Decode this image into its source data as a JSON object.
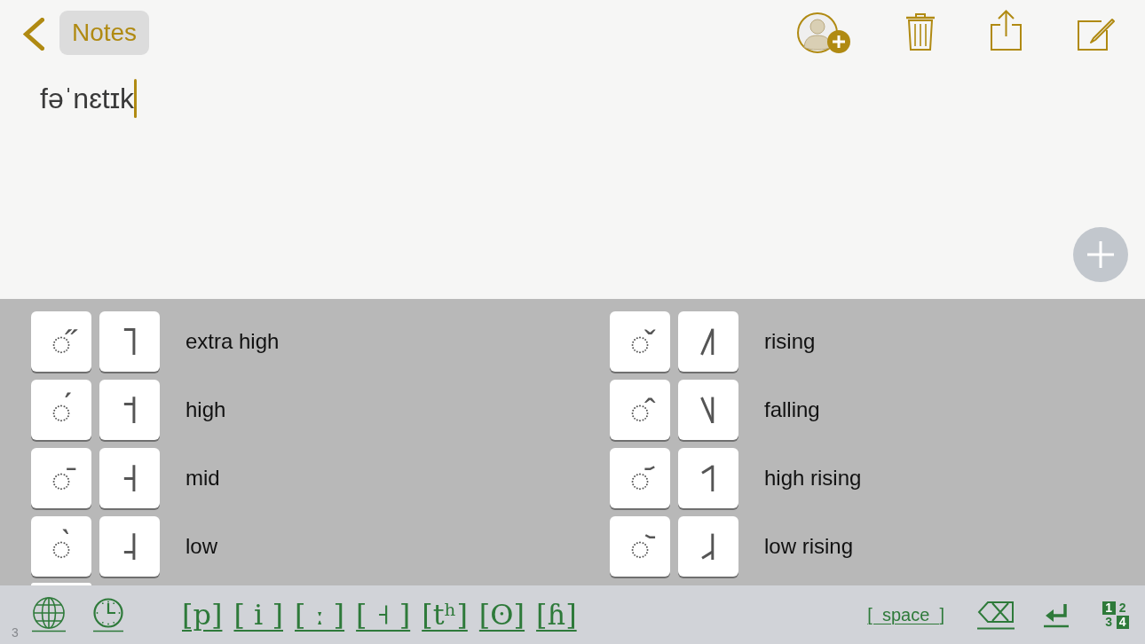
{
  "nav": {
    "back_label": "Notes"
  },
  "note": {
    "text": "fəˈnɛtɪk",
    "focused": true
  },
  "tone_keys": {
    "columns": [
      [
        {
          "mark": "◌̋",
          "tone_letter": "˥",
          "label": "extra high"
        },
        {
          "mark": "◌́",
          "tone_letter": "˦",
          "label": "high"
        },
        {
          "mark": "◌̄",
          "tone_letter": "˧",
          "label": "mid"
        },
        {
          "mark": "◌̀",
          "tone_letter": "˨",
          "label": "low"
        }
      ],
      [
        {
          "mark": "◌̌",
          "tone_letter": "˩˥",
          "label": "rising"
        },
        {
          "mark": "◌̂",
          "tone_letter": "˥˩",
          "label": "falling"
        },
        {
          "mark": "◌᷄",
          "tone_letter": "˦˥",
          "label": "high rising"
        },
        {
          "mark": "◌᷅",
          "tone_letter": "˩˨",
          "label": "low rising"
        }
      ]
    ]
  },
  "symbol_bar": {
    "page": "3",
    "symbols": [
      "[p]",
      "[ i ]",
      "[ ː ]",
      "[ ˧ ]",
      "[tʰ]",
      "[ʘ]",
      "[ɦ]"
    ],
    "space_label": "[  space  ]",
    "number_key": [
      {
        "digit": "1",
        "filled": true
      },
      {
        "digit": "2",
        "filled": false
      },
      {
        "digit": "3",
        "filled": false
      },
      {
        "digit": "4",
        "filled": true
      }
    ]
  }
}
